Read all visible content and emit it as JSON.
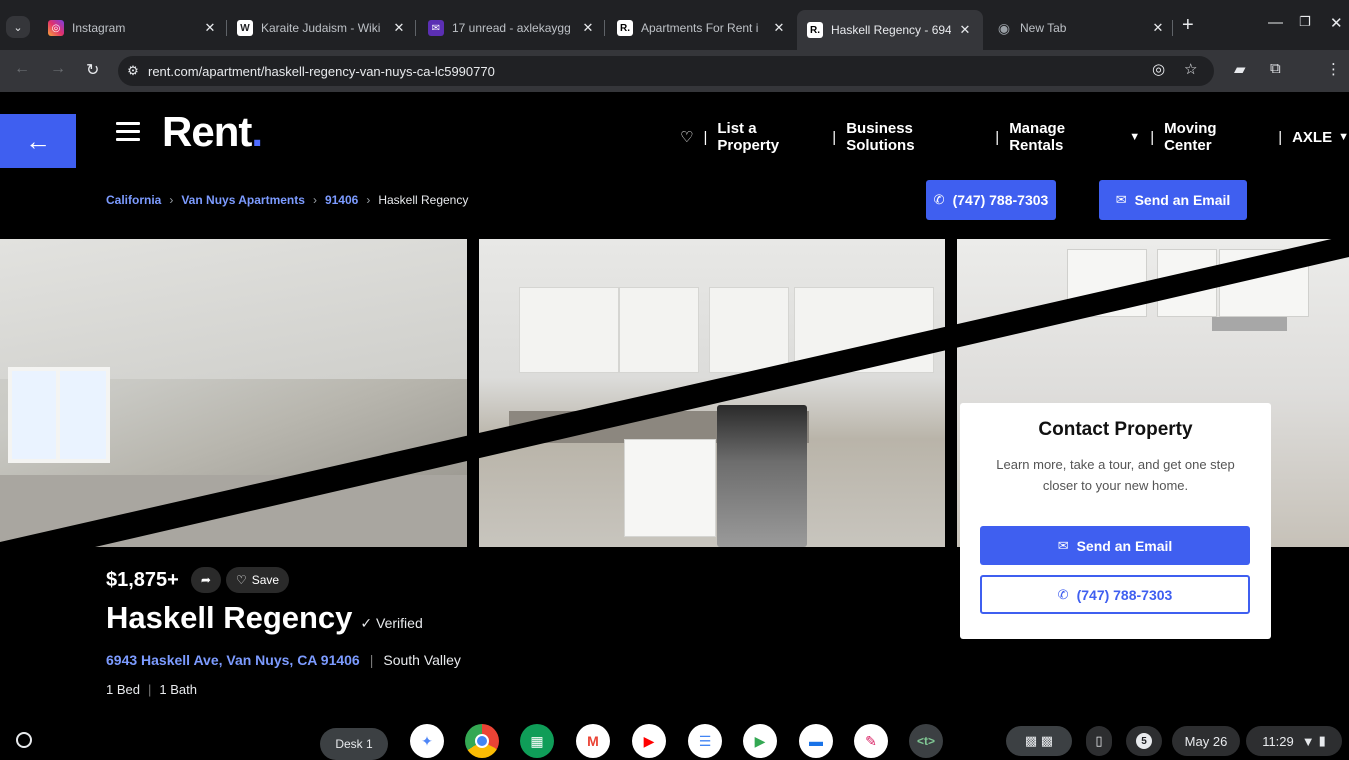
{
  "browser": {
    "tabs": [
      {
        "title": "Instagram",
        "favicon": "instagram-icon",
        "color": "#e1306c",
        "glyph": "◎"
      },
      {
        "title": "Karaite Judaism - Wiki",
        "favicon": "wikipedia-icon",
        "color": "#ffffff",
        "glyph": "W"
      },
      {
        "title": "17 unread - axlekaygg",
        "favicon": "mail-icon",
        "color": "#7b3fe4",
        "glyph": "✉"
      },
      {
        "title": "Apartments For Rent i",
        "favicon": "rent-icon",
        "color": "#ffffff",
        "glyph": "R."
      },
      {
        "title": "Haskell Regency - 694",
        "favicon": "rent-icon",
        "color": "#ffffff",
        "glyph": "R."
      },
      {
        "title": "New Tab",
        "favicon": "chrome-icon",
        "color": "#9aa0a6",
        "glyph": "◉"
      }
    ],
    "url": "rent.com/apartment/haskell-regency-van-nuys-ca-lc5990770"
  },
  "site": {
    "logo": "Rent",
    "nav": {
      "list_property": "List a Property",
      "business": "Business Solutions",
      "manage": "Manage Rentals",
      "moving": "Moving Center",
      "user": "AXLE"
    },
    "breadcrumb": [
      "California",
      "Van Nuys Apartments",
      "91406",
      "Haskell Regency"
    ],
    "phone": "(747) 788-7303",
    "email_label": "Send an Email"
  },
  "listing": {
    "price": "$1,875+",
    "save_label": "Save",
    "name": "Haskell Regency",
    "verified": "Verified",
    "address": "6943 Haskell Ave, Van Nuys, CA 91406",
    "area": "South Valley",
    "beds": "1 Bed",
    "baths": "1 Bath"
  },
  "contact": {
    "title": "Contact Property",
    "subtitle": "Learn more, take a tour, and get one step closer to your new home.",
    "email_label": "Send an Email",
    "phone": "(747) 788-7303"
  },
  "shelf": {
    "desk": "Desk 1",
    "notifications": "5",
    "date": "May 26",
    "time": "11:29"
  },
  "colors": {
    "accent": "#3f5ff0",
    "link": "#7c9bff",
    "background": "#000000"
  }
}
